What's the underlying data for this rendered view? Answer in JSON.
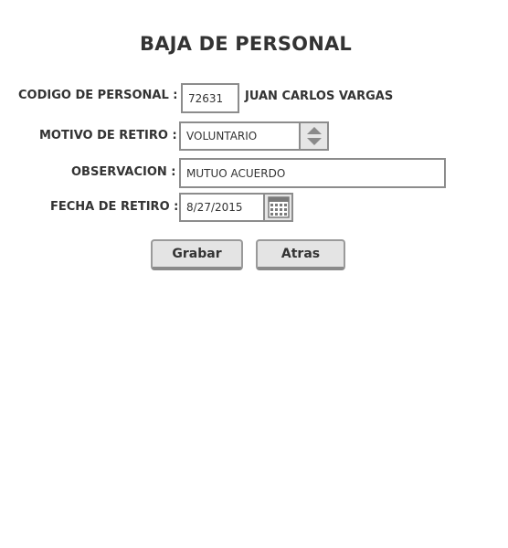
{
  "page": {
    "title": "BAJA DE PERSONAL"
  },
  "form": {
    "codigo": {
      "label": "CODIGO DE PERSONAL :",
      "value": "72631",
      "employee_name": "JUAN CARLOS VARGAS"
    },
    "motivo": {
      "label": "MOTIVO DE RETIRO :",
      "value": "VOLUNTARIO",
      "spinner_icon": "up-down-arrows-icon"
    },
    "observacion": {
      "label": "OBSERVACION :",
      "value": "MUTUO ACUERDO"
    },
    "fecha": {
      "label": "FECHA DE RETIRO :",
      "value": "8/27/2015",
      "calendar_icon": "calendar-icon"
    }
  },
  "actions": {
    "save_label": "Grabar",
    "back_label": "Atras"
  },
  "colors": {
    "border": "#8c8c8c",
    "button_bg": "#e4e4e4",
    "text": "#333333"
  }
}
